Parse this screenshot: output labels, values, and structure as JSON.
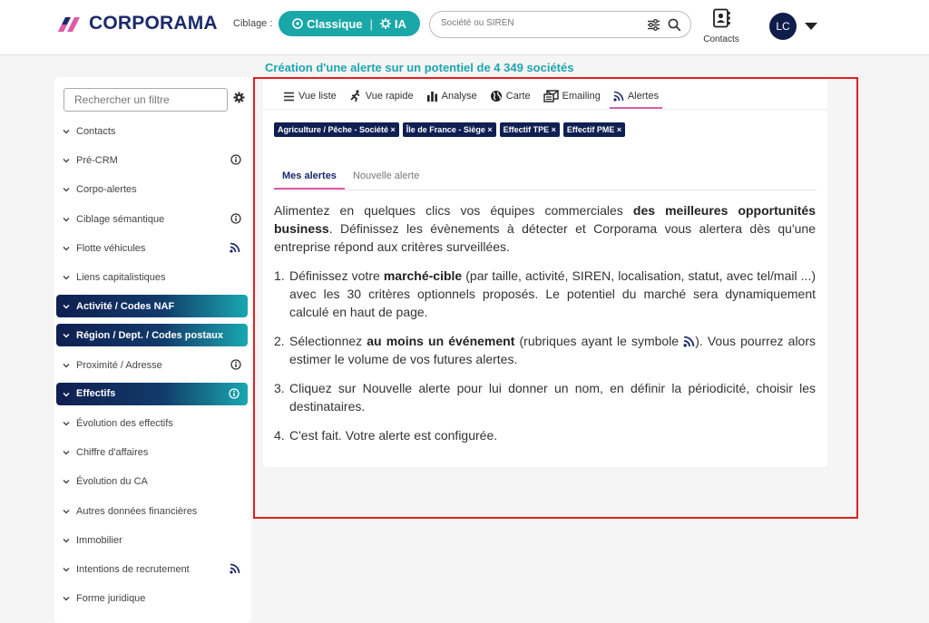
{
  "header": {
    "brand": "CORPORAMA",
    "ciblage_label": "Ciblage :",
    "mode_classique": "Classique",
    "mode_separator": "|",
    "mode_ia": "IA",
    "search_placeholder": "Société ou SIREN",
    "contacts_label": "Contacts",
    "avatar_initials": "LC"
  },
  "banner": "Création d'une alerte sur un potentiel de 4 349 sociétés",
  "sidebar": {
    "search_placeholder": "Rechercher un filtre",
    "items": [
      {
        "label": "Contacts"
      },
      {
        "label": "Pré-CRM",
        "icon": "info-icon"
      },
      {
        "label": "Corpo-alertes"
      },
      {
        "label": "Ciblage sémantique",
        "icon": "info-icon"
      },
      {
        "label": "Flotte véhicules",
        "icon": "rss-icon"
      },
      {
        "label": "Liens capitalistiques"
      },
      {
        "label": "Activité / Codes NAF",
        "active": true
      },
      {
        "label": "Région / Dept. / Codes postaux",
        "active": true
      },
      {
        "label": "Proximité / Adresse",
        "icon": "info-icon"
      },
      {
        "label": "Effectifs",
        "active": true,
        "icon": "info-icon"
      },
      {
        "label": "Évolution des effectifs"
      },
      {
        "label": "Chiffre d'affaires"
      },
      {
        "label": "Évolution du CA"
      },
      {
        "label": "Autres données financières"
      },
      {
        "label": "Immobilier"
      },
      {
        "label": "Intentions de recrutement",
        "icon": "rss-icon"
      },
      {
        "label": "Forme juridique"
      }
    ]
  },
  "views": {
    "tabs": [
      "Vue liste",
      "Vue rapide",
      "Analyse",
      "Carte",
      "Emailing",
      "Alertes"
    ],
    "selected": "Alertes"
  },
  "chips": [
    "Agriculture / Pêche - Société ×",
    "Île de France - Siège ×",
    "Effectif TPE ×",
    "Effectif PME ×"
  ],
  "sub_tabs": {
    "mes_alertes": "Mes alertes",
    "nouvelle_alerte": "Nouvelle alerte"
  },
  "content": {
    "intro_1": "Alimentez en quelques clics vos équipes commerciales ",
    "intro_bold": "des meilleures opportunités business",
    "intro_2": ". Définissez les évènements à détecter et Corporama vous alertera dès qu'une entreprise répond aux critères surveillées.",
    "step1_num": "1.",
    "step1_a": "Définissez votre ",
    "step1_bold": "marché-cible",
    "step1_b": " (par taille, activité, SIREN, localisation, statut, avec tel/mail ...) avec les 30 critères optionnels proposés. Le potentiel du marché sera dynamiquement calculé en haut de page.",
    "step2_num": "2.",
    "step2_a": "Sélectionnez ",
    "step2_bold": "au moins un événement",
    "step2_b": " (rubriques ayant le symbole ",
    "step2_c": "). Vous pourrez alors estimer le volume de vos futures alertes.",
    "step3_num": "3.",
    "step3": "Cliquez sur Nouvelle alerte pour lui donner un nom, en définir la périodicité, choisir les destinataires.",
    "step4_num": "4.",
    "step4": "C'est fait. Votre alerte est configurée."
  },
  "colors": {
    "accent_teal": "#1aa7a7",
    "navy": "#0f1f52",
    "pink_underline": "#e05aa8",
    "highlight_frame": "#e02020"
  }
}
